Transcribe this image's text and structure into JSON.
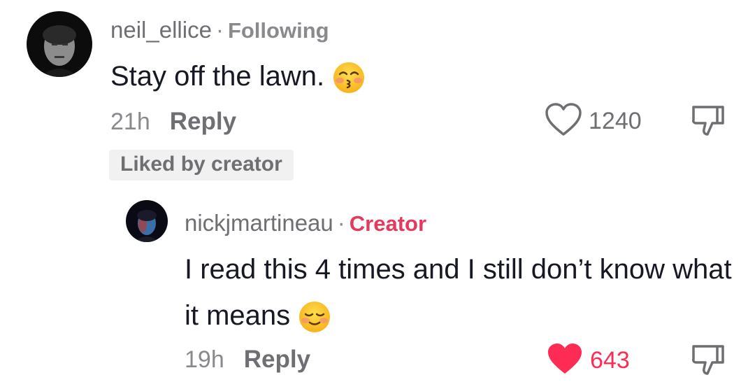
{
  "comments": [
    {
      "username": "neil_ellice",
      "separator": "·",
      "tag": "Following",
      "text": "Stay off the lawn.",
      "emoji": "kissing-face-with-smiling-eyes-icon",
      "time": "21h",
      "reply_label": "Reply",
      "likes": "1240",
      "liked": false,
      "badge": "Liked by creator"
    },
    {
      "username": "nickjmartineau",
      "separator": "·",
      "tag": "Creator",
      "text": "I read this 4 times and I still don’t know what it means",
      "emoji": "relieved-face-icon",
      "time": "19h",
      "reply_label": "Reply",
      "likes": "643",
      "liked": true
    }
  ],
  "colors": {
    "creator_tag": "#e43a5d",
    "liked_heart": "#fe2c55",
    "text": "#161823",
    "muted": "#8a8a8e"
  }
}
